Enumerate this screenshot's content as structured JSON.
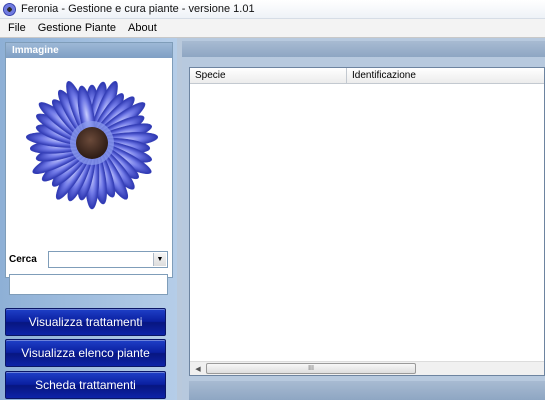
{
  "window": {
    "title": "Feronia - Gestione e cura piante - versione 1.01",
    "icon": "flower-app-icon"
  },
  "menu": {
    "items": [
      "File",
      "Gestione Piante",
      "About"
    ]
  },
  "image_panel": {
    "header": "Immagine",
    "image": "blue-daisy-flower"
  },
  "search": {
    "label": "Cerca",
    "selected": "",
    "text": ""
  },
  "buttons": {
    "view_treatments": "Visualizza trattamenti",
    "view_plant_list": "Visualizza elenco piante",
    "treatment_sheet": "Scheda trattamenti"
  },
  "list": {
    "columns": [
      "Specie",
      "Identificazione"
    ],
    "rows": [],
    "scroll_grip": "III"
  },
  "colors": {
    "button_blue": "#0a1fa0",
    "panel_blue": "#a4bfdf"
  }
}
